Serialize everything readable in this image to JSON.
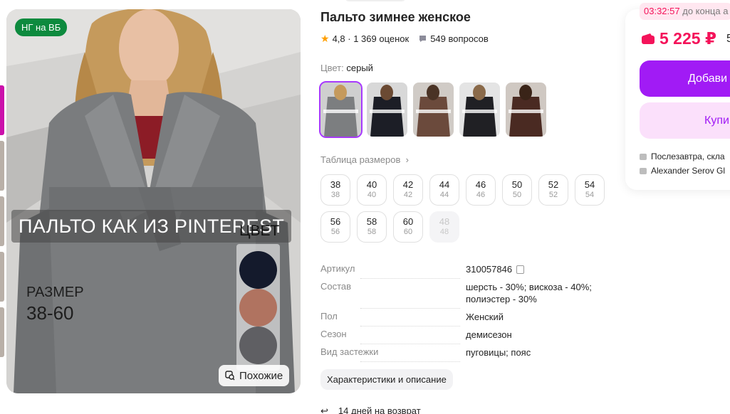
{
  "photo": {
    "badge": "НГ на ВБ",
    "overlay_title": "ПАЛЬТО КАК ИЗ PINTEREST",
    "size_label": "РАЗМЕР",
    "size_range": "38-60",
    "color_label": "ЦВЕТ",
    "color_dots": [
      "#141a2c",
      "#b07360",
      "#5f5f63"
    ],
    "similar_label": "Похожие"
  },
  "product": {
    "title": "Пальто зимнее женское",
    "rating": "4,8",
    "reviews": "1 369 оценок",
    "questions": "549 вопросов",
    "color_key": "Цвет:",
    "color_value": "серый",
    "swatches": [
      {
        "name": "серый",
        "color": "#7c7e80"
      },
      {
        "name": "черный",
        "color": "#1c1e26"
      },
      {
        "name": "коричневый",
        "color": "#6b4a3c"
      },
      {
        "name": "черный 2",
        "color": "#202024"
      },
      {
        "name": "шоколад",
        "color": "#4a2a22"
      }
    ],
    "size_table_link": "Таблица размеров",
    "sizes": [
      {
        "ru": "38",
        "alt": "38",
        "available": true
      },
      {
        "ru": "40",
        "alt": "40",
        "available": true
      },
      {
        "ru": "42",
        "alt": "42",
        "available": true
      },
      {
        "ru": "44",
        "alt": "44",
        "available": true
      },
      {
        "ru": "46",
        "alt": "46",
        "available": true
      },
      {
        "ru": "50",
        "alt": "50",
        "available": true
      },
      {
        "ru": "52",
        "alt": "52",
        "available": true
      },
      {
        "ru": "54",
        "alt": "54",
        "available": true
      },
      {
        "ru": "56",
        "alt": "56",
        "available": true
      },
      {
        "ru": "58",
        "alt": "58",
        "available": true
      },
      {
        "ru": "60",
        "alt": "60",
        "available": true
      },
      {
        "ru": "48",
        "alt": "48",
        "available": false
      }
    ],
    "specs": [
      {
        "key": "Артикул",
        "value": "310057846"
      },
      {
        "key": "Состав",
        "value": "шерсть - 30%; вискоза - 40%; полиэстер - 30%"
      },
      {
        "key": "Пол",
        "value": "Женский"
      },
      {
        "key": "Сезон",
        "value": "демисезон"
      },
      {
        "key": "Вид застежки",
        "value": "пуговицы; пояс"
      }
    ],
    "characteristics_button": "Характеристики и описание",
    "return_text": "14 дней на возврат"
  },
  "buy_card": {
    "timer": "03:32:57",
    "timer_suffix": "до конца а",
    "price": "5 225 ₽",
    "old_price": "5",
    "add_button": "Добави",
    "buy_button": "Купи",
    "delivery": "Послезавтра, скла",
    "seller": "Alexander Serov Gl"
  },
  "colors": {
    "accent": "#a11bf5",
    "price": "#f4135a",
    "badge": "#0d8a3e"
  }
}
